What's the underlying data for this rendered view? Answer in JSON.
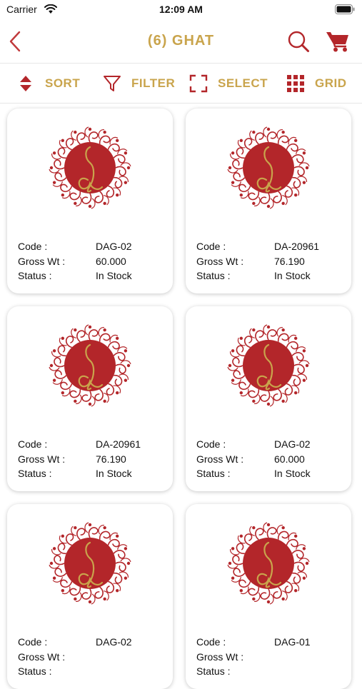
{
  "status_bar": {
    "carrier": "Carrier",
    "time": "12:09 AM"
  },
  "nav": {
    "title": "(6) GHAT",
    "icons": [
      "back-chevron-icon",
      "search-icon",
      "cart-icon"
    ]
  },
  "toolbar": {
    "sort": "SORT",
    "filter": "FILTER",
    "select": "SELECT",
    "grid": "GRID"
  },
  "colors": {
    "accent_gold": "#c9a44c",
    "brand_red": "#b3262a"
  },
  "labels": {
    "code": "Code :",
    "gross_wt": "Gross Wt :",
    "status": "Status :"
  },
  "products": [
    {
      "code": "DAG-02",
      "gross_wt": "60.000",
      "status": "In Stock"
    },
    {
      "code": "DA-20961",
      "gross_wt": "76.190",
      "status": "In Stock"
    },
    {
      "code": "DA-20961",
      "gross_wt": "76.190",
      "status": "In Stock"
    },
    {
      "code": "DAG-02",
      "gross_wt": "60.000",
      "status": "In Stock"
    },
    {
      "code": "DAG-02",
      "gross_wt": "",
      "status": ""
    },
    {
      "code": "DAG-01",
      "gross_wt": "",
      "status": ""
    }
  ]
}
